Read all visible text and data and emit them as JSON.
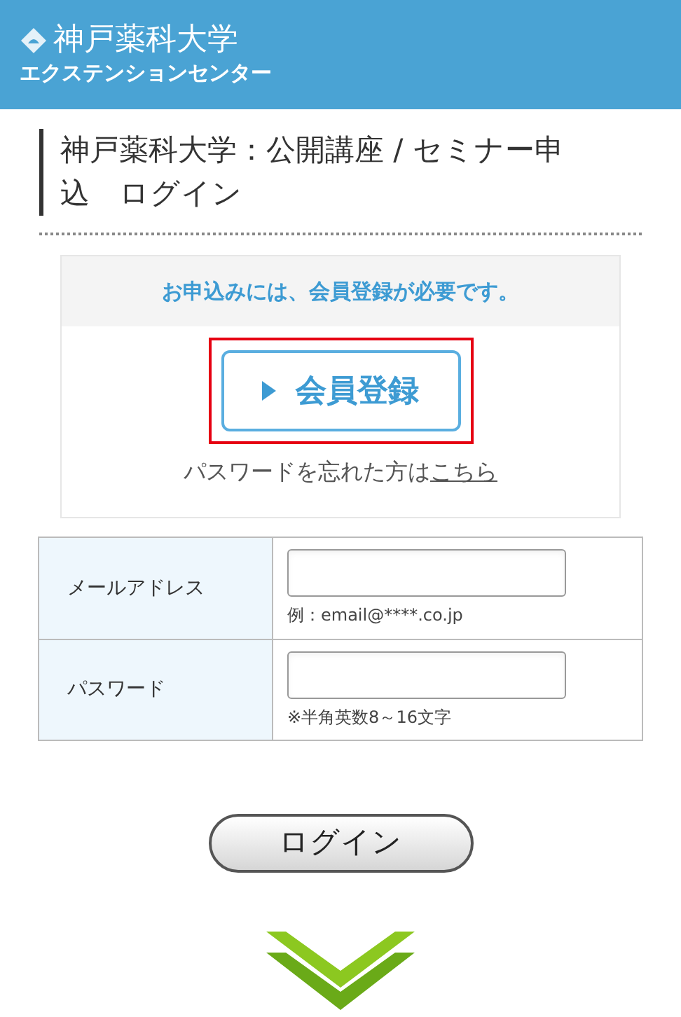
{
  "header": {
    "logo_title": "神戸薬科大学",
    "logo_subtitle": "エクステンションセンター"
  },
  "page_title": "神戸薬科大学：公開講座 / セミナー申込　ログイン",
  "register_box": {
    "notice": "お申込みには、会員登録が必要です。",
    "register_button": "会員登録",
    "highlighted": true,
    "forgot_text": "パスワードを忘れた方は",
    "forgot_link": "こちら"
  },
  "form": [
    {
      "label": "メールアドレス",
      "hint": "例：email@****.co.jp"
    },
    {
      "label": "パスワード",
      "hint": "※半角英数8～16文字"
    }
  ],
  "login_button": "ログイン"
}
